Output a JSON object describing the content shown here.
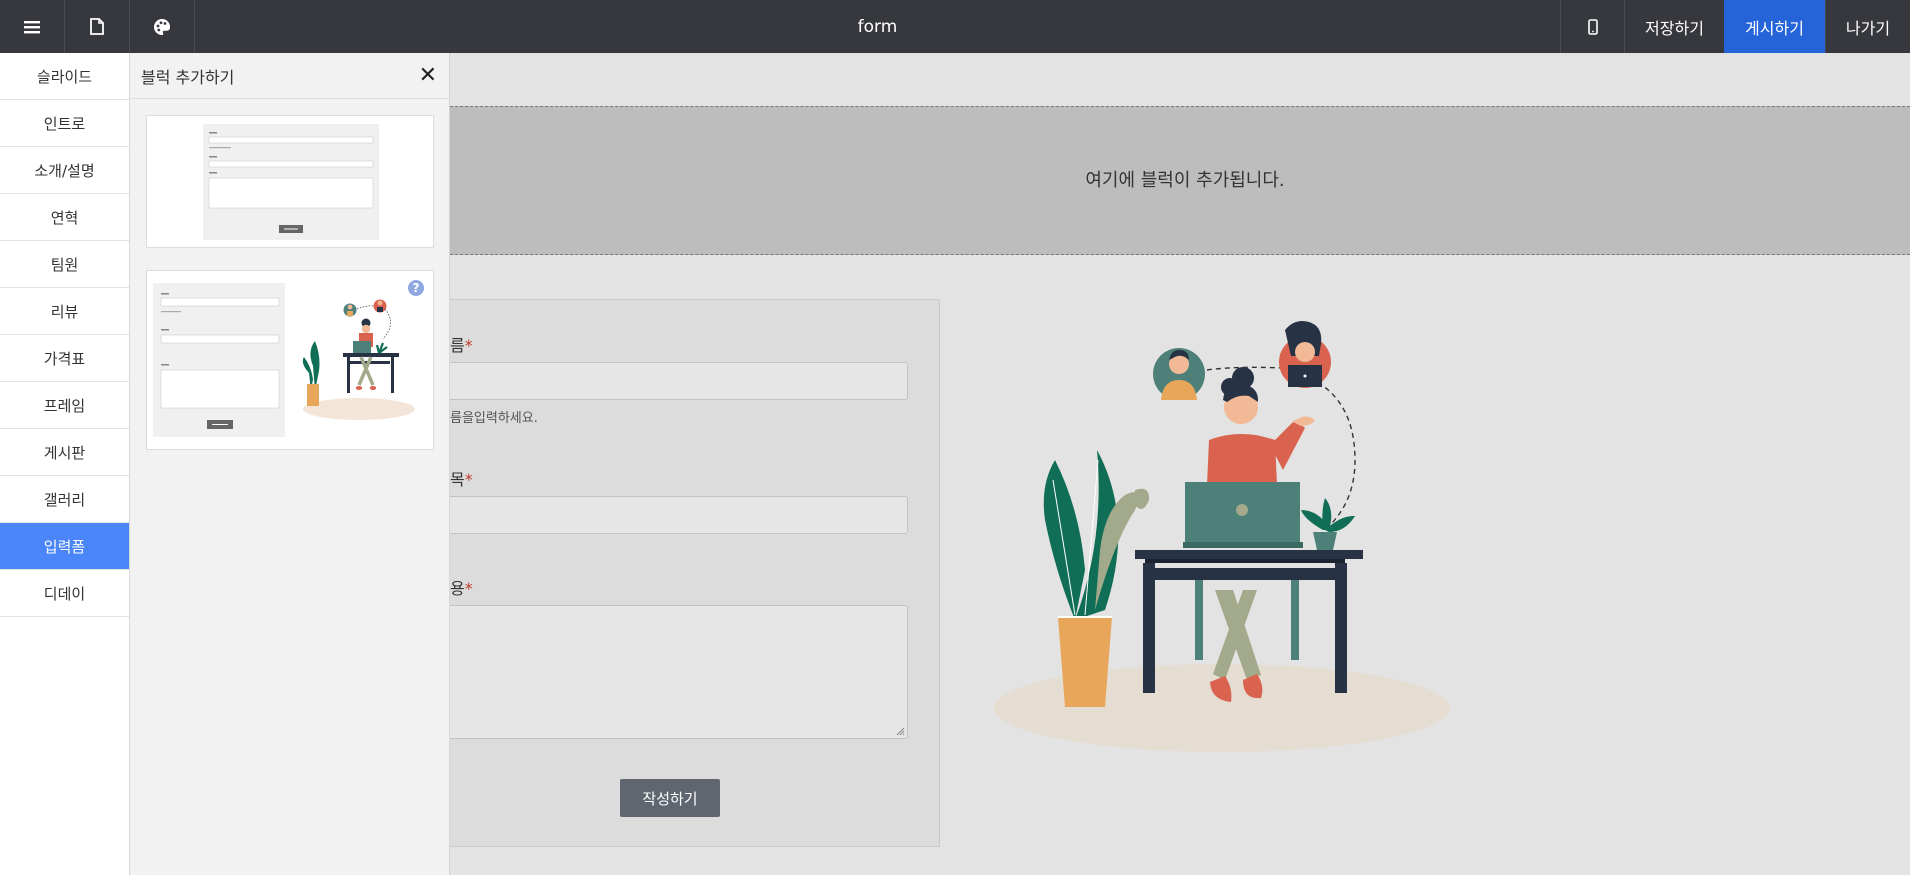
{
  "topbar": {
    "title": "form",
    "icons": [
      "menu-icon",
      "page-icon",
      "palette-icon"
    ],
    "mobile_icon": "mobile-icon",
    "save_label": "저장하기",
    "publish_label": "게시하기",
    "exit_label": "나가기"
  },
  "categories": [
    {
      "label": "슬라이드"
    },
    {
      "label": "인트로"
    },
    {
      "label": "소개/설명"
    },
    {
      "label": "연혁"
    },
    {
      "label": "팀원"
    },
    {
      "label": "리뷰"
    },
    {
      "label": "가격표"
    },
    {
      "label": "프레임"
    },
    {
      "label": "게시판"
    },
    {
      "label": "갤러리"
    },
    {
      "label": "입력폼"
    },
    {
      "label": "디데이"
    }
  ],
  "active_category": "입력폼",
  "block_panel": {
    "title": "블럭 추가하기",
    "close_icon": "close-icon",
    "help_icon": "question-icon"
  },
  "canvas": {
    "drop_zone_text": "여기에 블럭이 추가됩니다.",
    "form": {
      "name_label": "름",
      "name_help": "름을입력하세요.",
      "subject_label": "목",
      "content_label": "용",
      "required_mark": "*",
      "submit_label": "작성하기"
    }
  },
  "colors": {
    "topbar": "#36383d",
    "publish": "#2563d9",
    "active_category": "#4a86f7",
    "submit": "#5f6670",
    "required": "#c0392b"
  }
}
